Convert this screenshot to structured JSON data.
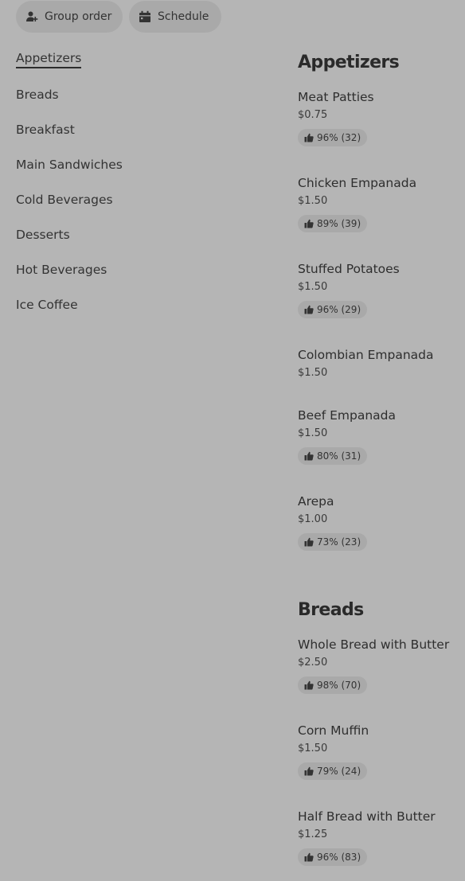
{
  "toolbar": {
    "group_order_label": "Group order",
    "schedule_label": "Schedule",
    "group_order_icon": "person-add-icon",
    "schedule_icon": "calendar-icon"
  },
  "categories": [
    {
      "label": "Appetizers",
      "active": true
    },
    {
      "label": "Breads",
      "active": false
    },
    {
      "label": "Breakfast",
      "active": false
    },
    {
      "label": "Main Sandwiches",
      "active": false
    },
    {
      "label": "Cold Beverages",
      "active": false
    },
    {
      "label": "Desserts",
      "active": false
    },
    {
      "label": "Hot Beverages",
      "active": false
    },
    {
      "label": "Ice Coffee",
      "active": false
    }
  ],
  "sections": [
    {
      "title": "Appetizers",
      "items": [
        {
          "name": "Meat Patties",
          "price": "$0.75",
          "rating": "96% (32)"
        },
        {
          "name": "Chicken Empanada",
          "price": "$1.50",
          "rating": "89% (39)"
        },
        {
          "name": "Stuffed Potatoes",
          "price": "$1.50",
          "rating": "96% (29)"
        },
        {
          "name": "Colombian Empanada",
          "price": "$1.50",
          "rating": null
        },
        {
          "name": "Beef Empanada",
          "price": "$1.50",
          "rating": "80% (31)"
        },
        {
          "name": "Arepa",
          "price": "$1.00",
          "rating": "73% (23)"
        }
      ]
    },
    {
      "title": "Breads",
      "items": [
        {
          "name": "Whole Bread with Butter",
          "price": "$2.50",
          "rating": "98% (70)"
        },
        {
          "name": "Corn Muffin",
          "price": "$1.50",
          "rating": "79% (24)"
        },
        {
          "name": "Half Bread with Butter",
          "price": "$1.25",
          "rating": "96% (83)"
        }
      ]
    }
  ],
  "colors": {
    "background": "#b5b5b5",
    "pill_background": "#a9a9a9",
    "text": "#2a2a2a"
  }
}
